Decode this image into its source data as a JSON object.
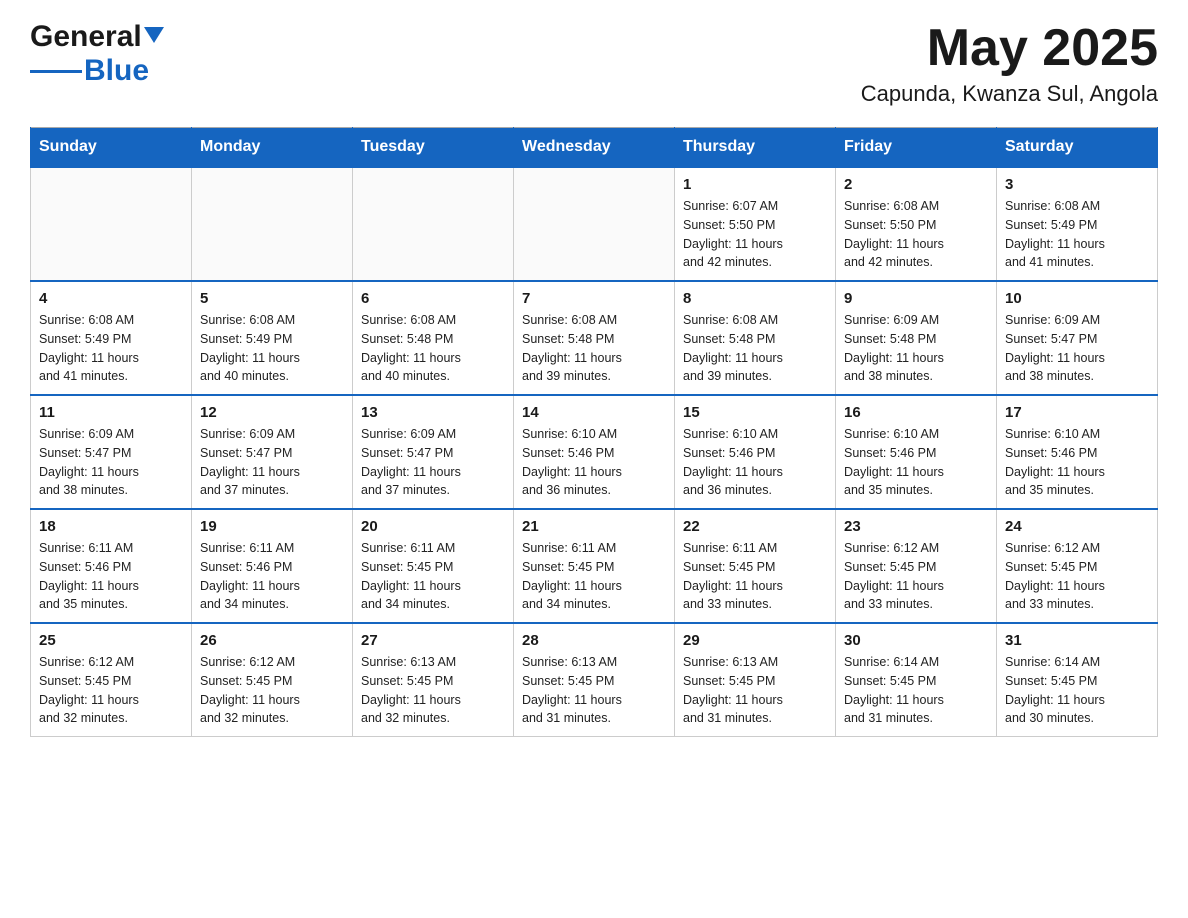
{
  "header": {
    "logo": {
      "general": "General",
      "blue": "Blue",
      "triangle": "▼"
    },
    "title": "May 2025",
    "location": "Capunda, Kwanza Sul, Angola"
  },
  "days_of_week": [
    "Sunday",
    "Monday",
    "Tuesday",
    "Wednesday",
    "Thursday",
    "Friday",
    "Saturday"
  ],
  "weeks": [
    [
      {
        "day": "",
        "info": ""
      },
      {
        "day": "",
        "info": ""
      },
      {
        "day": "",
        "info": ""
      },
      {
        "day": "",
        "info": ""
      },
      {
        "day": "1",
        "info": "Sunrise: 6:07 AM\nSunset: 5:50 PM\nDaylight: 11 hours\nand 42 minutes."
      },
      {
        "day": "2",
        "info": "Sunrise: 6:08 AM\nSunset: 5:50 PM\nDaylight: 11 hours\nand 42 minutes."
      },
      {
        "day": "3",
        "info": "Sunrise: 6:08 AM\nSunset: 5:49 PM\nDaylight: 11 hours\nand 41 minutes."
      }
    ],
    [
      {
        "day": "4",
        "info": "Sunrise: 6:08 AM\nSunset: 5:49 PM\nDaylight: 11 hours\nand 41 minutes."
      },
      {
        "day": "5",
        "info": "Sunrise: 6:08 AM\nSunset: 5:49 PM\nDaylight: 11 hours\nand 40 minutes."
      },
      {
        "day": "6",
        "info": "Sunrise: 6:08 AM\nSunset: 5:48 PM\nDaylight: 11 hours\nand 40 minutes."
      },
      {
        "day": "7",
        "info": "Sunrise: 6:08 AM\nSunset: 5:48 PM\nDaylight: 11 hours\nand 39 minutes."
      },
      {
        "day": "8",
        "info": "Sunrise: 6:08 AM\nSunset: 5:48 PM\nDaylight: 11 hours\nand 39 minutes."
      },
      {
        "day": "9",
        "info": "Sunrise: 6:09 AM\nSunset: 5:48 PM\nDaylight: 11 hours\nand 38 minutes."
      },
      {
        "day": "10",
        "info": "Sunrise: 6:09 AM\nSunset: 5:47 PM\nDaylight: 11 hours\nand 38 minutes."
      }
    ],
    [
      {
        "day": "11",
        "info": "Sunrise: 6:09 AM\nSunset: 5:47 PM\nDaylight: 11 hours\nand 38 minutes."
      },
      {
        "day": "12",
        "info": "Sunrise: 6:09 AM\nSunset: 5:47 PM\nDaylight: 11 hours\nand 37 minutes."
      },
      {
        "day": "13",
        "info": "Sunrise: 6:09 AM\nSunset: 5:47 PM\nDaylight: 11 hours\nand 37 minutes."
      },
      {
        "day": "14",
        "info": "Sunrise: 6:10 AM\nSunset: 5:46 PM\nDaylight: 11 hours\nand 36 minutes."
      },
      {
        "day": "15",
        "info": "Sunrise: 6:10 AM\nSunset: 5:46 PM\nDaylight: 11 hours\nand 36 minutes."
      },
      {
        "day": "16",
        "info": "Sunrise: 6:10 AM\nSunset: 5:46 PM\nDaylight: 11 hours\nand 35 minutes."
      },
      {
        "day": "17",
        "info": "Sunrise: 6:10 AM\nSunset: 5:46 PM\nDaylight: 11 hours\nand 35 minutes."
      }
    ],
    [
      {
        "day": "18",
        "info": "Sunrise: 6:11 AM\nSunset: 5:46 PM\nDaylight: 11 hours\nand 35 minutes."
      },
      {
        "day": "19",
        "info": "Sunrise: 6:11 AM\nSunset: 5:46 PM\nDaylight: 11 hours\nand 34 minutes."
      },
      {
        "day": "20",
        "info": "Sunrise: 6:11 AM\nSunset: 5:45 PM\nDaylight: 11 hours\nand 34 minutes."
      },
      {
        "day": "21",
        "info": "Sunrise: 6:11 AM\nSunset: 5:45 PM\nDaylight: 11 hours\nand 34 minutes."
      },
      {
        "day": "22",
        "info": "Sunrise: 6:11 AM\nSunset: 5:45 PM\nDaylight: 11 hours\nand 33 minutes."
      },
      {
        "day": "23",
        "info": "Sunrise: 6:12 AM\nSunset: 5:45 PM\nDaylight: 11 hours\nand 33 minutes."
      },
      {
        "day": "24",
        "info": "Sunrise: 6:12 AM\nSunset: 5:45 PM\nDaylight: 11 hours\nand 33 minutes."
      }
    ],
    [
      {
        "day": "25",
        "info": "Sunrise: 6:12 AM\nSunset: 5:45 PM\nDaylight: 11 hours\nand 32 minutes."
      },
      {
        "day": "26",
        "info": "Sunrise: 6:12 AM\nSunset: 5:45 PM\nDaylight: 11 hours\nand 32 minutes."
      },
      {
        "day": "27",
        "info": "Sunrise: 6:13 AM\nSunset: 5:45 PM\nDaylight: 11 hours\nand 32 minutes."
      },
      {
        "day": "28",
        "info": "Sunrise: 6:13 AM\nSunset: 5:45 PM\nDaylight: 11 hours\nand 31 minutes."
      },
      {
        "day": "29",
        "info": "Sunrise: 6:13 AM\nSunset: 5:45 PM\nDaylight: 11 hours\nand 31 minutes."
      },
      {
        "day": "30",
        "info": "Sunrise: 6:14 AM\nSunset: 5:45 PM\nDaylight: 11 hours\nand 31 minutes."
      },
      {
        "day": "31",
        "info": "Sunrise: 6:14 AM\nSunset: 5:45 PM\nDaylight: 11 hours\nand 30 minutes."
      }
    ]
  ]
}
